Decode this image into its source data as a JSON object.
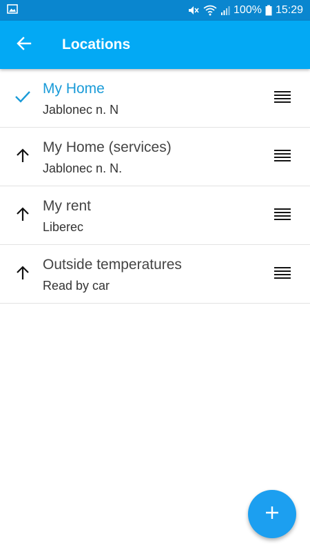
{
  "status_bar": {
    "battery_text": "100%",
    "time": "15:29",
    "icons": [
      "gallery-icon",
      "mute-icon",
      "wifi-icon",
      "signal-icon",
      "battery-icon"
    ]
  },
  "app_bar": {
    "title": "Locations",
    "back_icon": "arrow-left-icon"
  },
  "locations": [
    {
      "title": "My Home",
      "subtitle": "Jablonec n. N",
      "state": "selected",
      "icon": "check-icon"
    },
    {
      "title": "My Home (services)",
      "subtitle": "Jablonec n. N.",
      "state": "normal",
      "icon": "arrow-up-icon"
    },
    {
      "title": "My rent",
      "subtitle": "Liberec",
      "state": "normal",
      "icon": "arrow-up-icon"
    },
    {
      "title": "Outside temperatures",
      "subtitle": "Read by car",
      "state": "normal",
      "icon": "arrow-up-icon"
    }
  ],
  "fab": {
    "icon": "plus-icon"
  },
  "colors": {
    "status_bar": "#0a86cf",
    "app_bar": "#03a9f4",
    "accent": "#1a9bd8",
    "fab": "#1c9ff0"
  }
}
